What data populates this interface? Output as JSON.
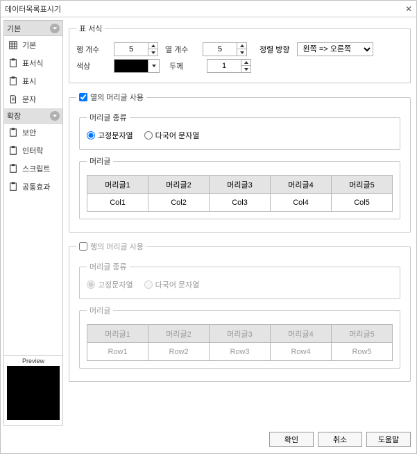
{
  "window": {
    "title": "데이터목록표시기"
  },
  "sidebar": {
    "sections": {
      "basic": "기본",
      "ext": "확장"
    },
    "items": [
      {
        "label": "기본"
      },
      {
        "label": "표서식"
      },
      {
        "label": "표시"
      },
      {
        "label": "문자"
      },
      {
        "label": "보안"
      },
      {
        "label": "인터락"
      },
      {
        "label": "스크립트"
      },
      {
        "label": "공통효과"
      }
    ],
    "preview_label": "Preview"
  },
  "form": {
    "group_table": "표 서식",
    "rows_label": "행 개수",
    "cols_label": "열 개수",
    "rows_value": "5",
    "cols_value": "5",
    "align_label": "정렬 방향",
    "align_value": "왼쪽 => 오른쪽",
    "color_label": "색상",
    "thickness_label": "두께",
    "thickness_value": "1",
    "col_header_use": "열의 머리글 사용",
    "row_header_use": "행의 머리글 사용",
    "header_type_title": "머리글 종류",
    "header_type_fixed": "고정문자열",
    "header_type_multi": "다국어 문자열",
    "header_title": "머리글",
    "col_headers": [
      "머리글1",
      "머리글2",
      "머리글3",
      "머리글4",
      "머리글5"
    ],
    "col_values": [
      "Col1",
      "Col2",
      "Col3",
      "Col4",
      "Col5"
    ],
    "row_headers": [
      "머리글1",
      "머리글2",
      "머리글3",
      "머리글4",
      "머리글5"
    ],
    "row_values": [
      "Row1",
      "Row2",
      "Row3",
      "Row4",
      "Row5"
    ]
  },
  "buttons": {
    "ok": "확인",
    "cancel": "취소",
    "help": "도움말"
  }
}
